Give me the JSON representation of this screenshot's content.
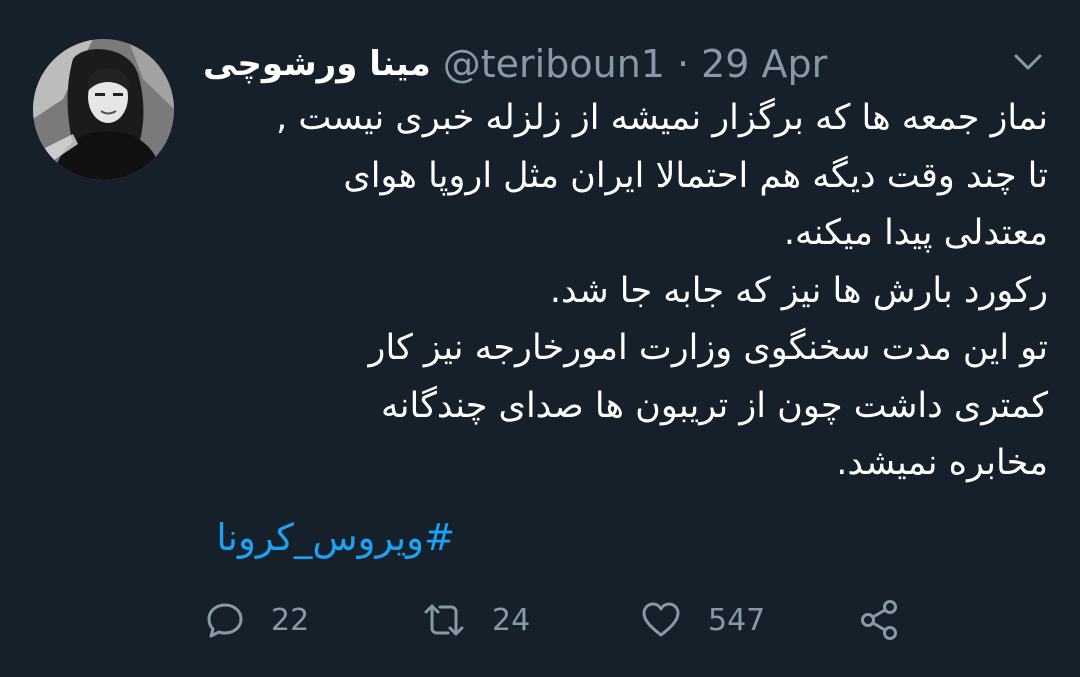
{
  "tweet": {
    "display_name": "مینا ورشوچی",
    "handle": "@teriboun1",
    "separator": "·",
    "date": "29 Apr",
    "body_lines": [
      "نماز جمعه ها که برگزار نمیشه از زلزله خبری نیست ,",
      "تا چند وقت دیگه هم احتمالا ایران مثل اروپا هوای",
      "معتدلی پیدا میکنه.",
      "رکورد بارش ها نیز که جابه جا شد.",
      "تو این مدت سخنگوی وزارت امورخارجه نیز کار",
      "کمتری داشت چون از تریبون ها صدای چندگانه",
      "مخابره نمیشد."
    ],
    "hashtag": "#ویروس_کرونا"
  },
  "actions": {
    "reply_count": "22",
    "retweet_count": "24",
    "like_count": "547"
  },
  "icons": {
    "avatar": "avatar",
    "menu": "chevron-down-icon",
    "reply": "reply-icon",
    "retweet": "retweet-icon",
    "like": "heart-icon",
    "share": "share-icon"
  },
  "colors": {
    "background": "#15202b",
    "text": "#ffffff",
    "secondary": "#8899a6",
    "link": "#1da1f2"
  }
}
